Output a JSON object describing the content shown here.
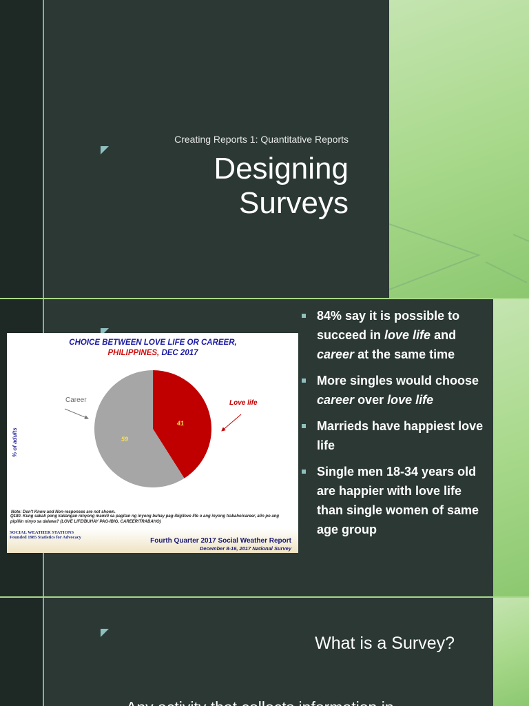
{
  "slide1": {
    "subtitle": "Creating Reports 1: Quantitative Reports",
    "title_line1": "Designing",
    "title_line2": "Surveys"
  },
  "slide2": {
    "bullets": [
      {
        "parts": [
          {
            "t": "84% say it is possible to succeed in ",
            "i": false
          },
          {
            "t": "love life",
            "i": true
          },
          {
            "t": " and ",
            "i": false
          },
          {
            "t": "career",
            "i": true
          },
          {
            "t": " at the same time",
            "i": false
          }
        ]
      },
      {
        "parts": [
          {
            "t": "More singles would choose ",
            "i": false
          },
          {
            "t": "career",
            "i": true
          },
          {
            "t": " over ",
            "i": false
          },
          {
            "t": "love life",
            "i": true
          }
        ]
      },
      {
        "parts": [
          {
            "t": "Marrieds have happiest love life",
            "i": false
          }
        ]
      },
      {
        "parts": [
          {
            "t": "Single men 18-34 years old are happier with love life than single women of same age group",
            "i": false
          }
        ]
      }
    ]
  },
  "chart_data": {
    "type": "pie",
    "title_line1": "CHOICE BETWEEN LOVE LIFE OR CAREER,",
    "title_red": "PHILIPPINES,",
    "title_blue": "DEC 2017",
    "ylabel": "% of adults",
    "slices": [
      {
        "label": "Love life",
        "value": 41,
        "color": "#c00000"
      },
      {
        "label": "Career",
        "value": 59,
        "color": "#a6a6a6"
      }
    ],
    "note": "Note: Don't Know and Non-responses are not shown.",
    "question": "Q180. Kung sakali pong kailangan ninyong mamili sa pagitan ng inyong buhay pag-ibig/love life o ang inyong trabaho/career, alin po ang pipiliin ninyo sa dalawa? (LOVE LIFE/BUHAY PAG-IBIG, CAREER/TRABAHO)",
    "logo": "SOCIAL WEATHER STATIONS Founded 1985 Statistics for Advocacy",
    "footer1": "Fourth Quarter 2017 Social Weather Report",
    "footer2": "December 8-16, 2017 National Survey"
  },
  "slide3": {
    "title": "What is a Survey?",
    "bullet": "Any activity that collects information in"
  }
}
